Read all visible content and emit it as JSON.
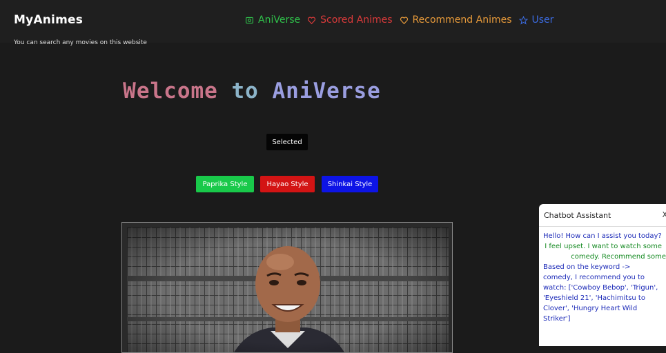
{
  "header": {
    "brand": "MyAnimes",
    "subtitle": "You can search any movies on this website",
    "nav": [
      {
        "label": "AniVerse",
        "color": "#2fc04a",
        "icon": "camera-icon"
      },
      {
        "label": "Scored Animes",
        "color": "#d93a3a",
        "icon": "heart-icon"
      },
      {
        "label": "Recommend Animes",
        "color": "#e79a3a",
        "icon": "heart-icon"
      },
      {
        "label": "User",
        "color": "#3b6be0",
        "icon": "star-icon"
      }
    ]
  },
  "hero": {
    "word1": "Welcome",
    "word2": "to",
    "word3": "AniVerse"
  },
  "selected_label": "Selected",
  "style_buttons": {
    "paprika": "Paprika Style",
    "hayao": "Hayao Style",
    "shinkai": "Shinkai Style"
  },
  "chatbot": {
    "title": "Chatbot Assistant",
    "close": "X",
    "messages": [
      {
        "role": "bot",
        "text": "Hello! How can I assist you today?"
      },
      {
        "role": "user",
        "line1": "I feel upset. I want to watch some",
        "line2": "comedy. Recommend some"
      },
      {
        "role": "bot",
        "text": "Based on the keyword -> comedy, I recommend you to watch: ['Cowboy Bebop', 'Trigun', 'Eyeshield 21', 'Hachimitsu to Clover', 'Hungry Heart Wild Striker']"
      }
    ]
  }
}
